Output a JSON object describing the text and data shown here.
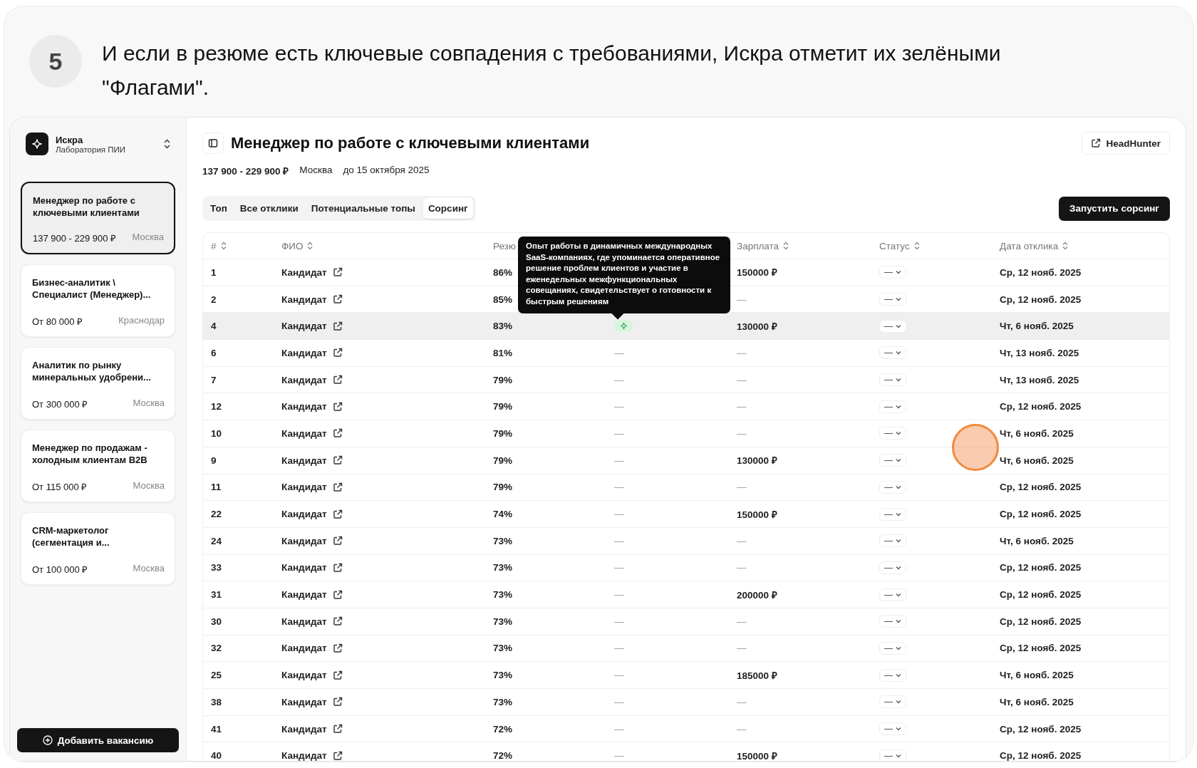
{
  "step": {
    "number": "5",
    "caption": "И если в резюме есть ключевые совпадения с требованиями, Искра отметит их зелёными \"Флагами\"."
  },
  "workspace": {
    "name": "Искра",
    "subtitle": "Лаборатория ПИИ"
  },
  "vacancies": [
    {
      "title": "Менеджер по работе с ключевыми клиентами",
      "salary": "137 900 - 229 900 ₽",
      "city": "Москва",
      "selected": true
    },
    {
      "title": "Бизнес-аналитик \\ Специалист (Менеджер)...",
      "salary": "От 80 000 ₽",
      "city": "Краснодар",
      "selected": false
    },
    {
      "title": "Аналитик по рынку минеральных удобрени...",
      "salary": "От 300 000 ₽",
      "city": "Москва",
      "selected": false
    },
    {
      "title": "Менеджер по продажам - холодным клиентам B2B",
      "salary": "От 115 000 ₽",
      "city": "Москва",
      "selected": false
    },
    {
      "title": "CRM-маркетолог (сегментация и...",
      "salary": "От 100 000 ₽",
      "city": "Москва",
      "selected": false
    }
  ],
  "add_button": "Добавить вакансию",
  "header": {
    "title": "Менеджер по работе с ключевыми клиентами",
    "salary": "137 900 - 229 900 ₽",
    "city": "Москва",
    "deadline": "до 15 октября 2025",
    "link": "HeadHunter"
  },
  "tabs": [
    {
      "label": "Топ",
      "selected": false
    },
    {
      "label": "Все отклики",
      "selected": false
    },
    {
      "label": "Потенциальные топы",
      "selected": false
    },
    {
      "label": "Сорсинг",
      "selected": true
    }
  ],
  "action_button": "Запустить сорсинг",
  "table": {
    "columns": [
      {
        "label": "#",
        "sortable": true
      },
      {
        "label": "ФИО",
        "sortable": true
      },
      {
        "label": "Резю",
        "sortable": false
      },
      {
        "sortable": false
      },
      {
        "label": "Зарплата",
        "sortable": true
      },
      {
        "label": "Статус",
        "sortable": true
      },
      {
        "label": "Дата отклика",
        "sortable": true
      }
    ],
    "rows": [
      {
        "num": "1",
        "name": "Кандидат",
        "score": "86%",
        "salary": "150000 ₽",
        "status": "—",
        "date": "Ср, 12 нояб. 2025",
        "hovered": false
      },
      {
        "num": "2",
        "name": "Кандидат",
        "score": "85%",
        "salary": "—",
        "status": "—",
        "date": "Ср, 12 нояб. 2025",
        "hovered": false
      },
      {
        "num": "4",
        "name": "Кандидат",
        "score": "83%",
        "flag": {
          "kind": "flag"
        },
        "salary": "130000 ₽",
        "status": "—",
        "date": "Чт, 6 нояб. 2025",
        "hovered": true
      },
      {
        "num": "6",
        "name": "Кандидат",
        "score": "81%",
        "flag": {
          "kind": "dash",
          "text": "—"
        },
        "salary": "—",
        "status": "—",
        "date": "Чт, 13 нояб. 2025",
        "hovered": false
      },
      {
        "num": "7",
        "name": "Кандидат",
        "score": "79%",
        "flag": {
          "kind": "dash",
          "text": "—"
        },
        "salary": "—",
        "status": "—",
        "date": "Чт, 13 нояб. 2025",
        "hovered": false
      },
      {
        "num": "12",
        "name": "Кандидат",
        "score": "79%",
        "flag": {
          "kind": "dash",
          "text": "—"
        },
        "salary": "—",
        "status": "—",
        "date": "Ср, 12 нояб. 2025",
        "hovered": false
      },
      {
        "num": "10",
        "name": "Кандидат",
        "score": "79%",
        "flag": {
          "kind": "dash",
          "text": "—"
        },
        "salary": "—",
        "status": "—",
        "date": "Чт, 6 нояб. 2025",
        "hovered": false
      },
      {
        "num": "9",
        "name": "Кандидат",
        "score": "79%",
        "flag": {
          "kind": "dash",
          "text": "—"
        },
        "salary": "130000 ₽",
        "status": "—",
        "date": "Чт, 6 нояб. 2025",
        "hovered": false
      },
      {
        "num": "11",
        "name": "Кандидат",
        "score": "79%",
        "flag": {
          "kind": "dash",
          "text": "—"
        },
        "salary": "—",
        "status": "—",
        "date": "Ср, 12 нояб. 2025",
        "hovered": false
      },
      {
        "num": "22",
        "name": "Кандидат",
        "score": "74%",
        "flag": {
          "kind": "dash",
          "text": "—"
        },
        "salary": "150000 ₽",
        "status": "—",
        "date": "Ср, 12 нояб. 2025",
        "hovered": false
      },
      {
        "num": "24",
        "name": "Кандидат",
        "score": "73%",
        "flag": {
          "kind": "dash",
          "text": "—"
        },
        "salary": "—",
        "status": "—",
        "date": "Чт, 6 нояб. 2025",
        "hovered": false
      },
      {
        "num": "33",
        "name": "Кандидат",
        "score": "73%",
        "flag": {
          "kind": "dash",
          "text": "—"
        },
        "salary": "—",
        "status": "—",
        "date": "Ср, 12 нояб. 2025",
        "hovered": false
      },
      {
        "num": "31",
        "name": "Кандидат",
        "score": "73%",
        "flag": {
          "kind": "dash",
          "text": "—"
        },
        "salary": "200000 ₽",
        "status": "—",
        "date": "Ср, 12 нояб. 2025",
        "hovered": false
      },
      {
        "num": "30",
        "name": "Кандидат",
        "score": "73%",
        "flag": {
          "kind": "dash",
          "text": "—"
        },
        "salary": "—",
        "status": "—",
        "date": "Ср, 12 нояб. 2025",
        "hovered": false
      },
      {
        "num": "32",
        "name": "Кандидат",
        "score": "73%",
        "flag": {
          "kind": "dash",
          "text": "—"
        },
        "salary": "—",
        "status": "—",
        "date": "Ср, 12 нояб. 2025",
        "hovered": false
      },
      {
        "num": "25",
        "name": "Кандидат",
        "score": "73%",
        "flag": {
          "kind": "dash",
          "text": "—"
        },
        "salary": "185000 ₽",
        "status": "—",
        "date": "Чт, 6 нояб. 2025",
        "hovered": false
      },
      {
        "num": "38",
        "name": "Кандидат",
        "score": "73%",
        "flag": {
          "kind": "dash",
          "text": "—"
        },
        "salary": "—",
        "status": "—",
        "date": "Чт, 6 нояб. 2025",
        "hovered": false
      },
      {
        "num": "41",
        "name": "Кандидат",
        "score": "72%",
        "flag": {
          "kind": "dash",
          "text": "—"
        },
        "salary": "—",
        "status": "—",
        "date": "Ср, 12 нояб. 2025",
        "hovered": false
      },
      {
        "num": "40",
        "name": "Кандидат",
        "score": "72%",
        "flag": {
          "kind": "dash",
          "text": "—"
        },
        "salary": "150000 ₽",
        "status": "—",
        "date": "Ср, 12 нояб. 2025",
        "hovered": false
      }
    ]
  },
  "tooltip": "Опыт работы в динамичных международных SaaS-компаниях, где упоминается оперативное решение проблем клиентов и участие в еженедельных межфункциональных совещаниях, свидетельствует о готовности к быстрым решениям"
}
